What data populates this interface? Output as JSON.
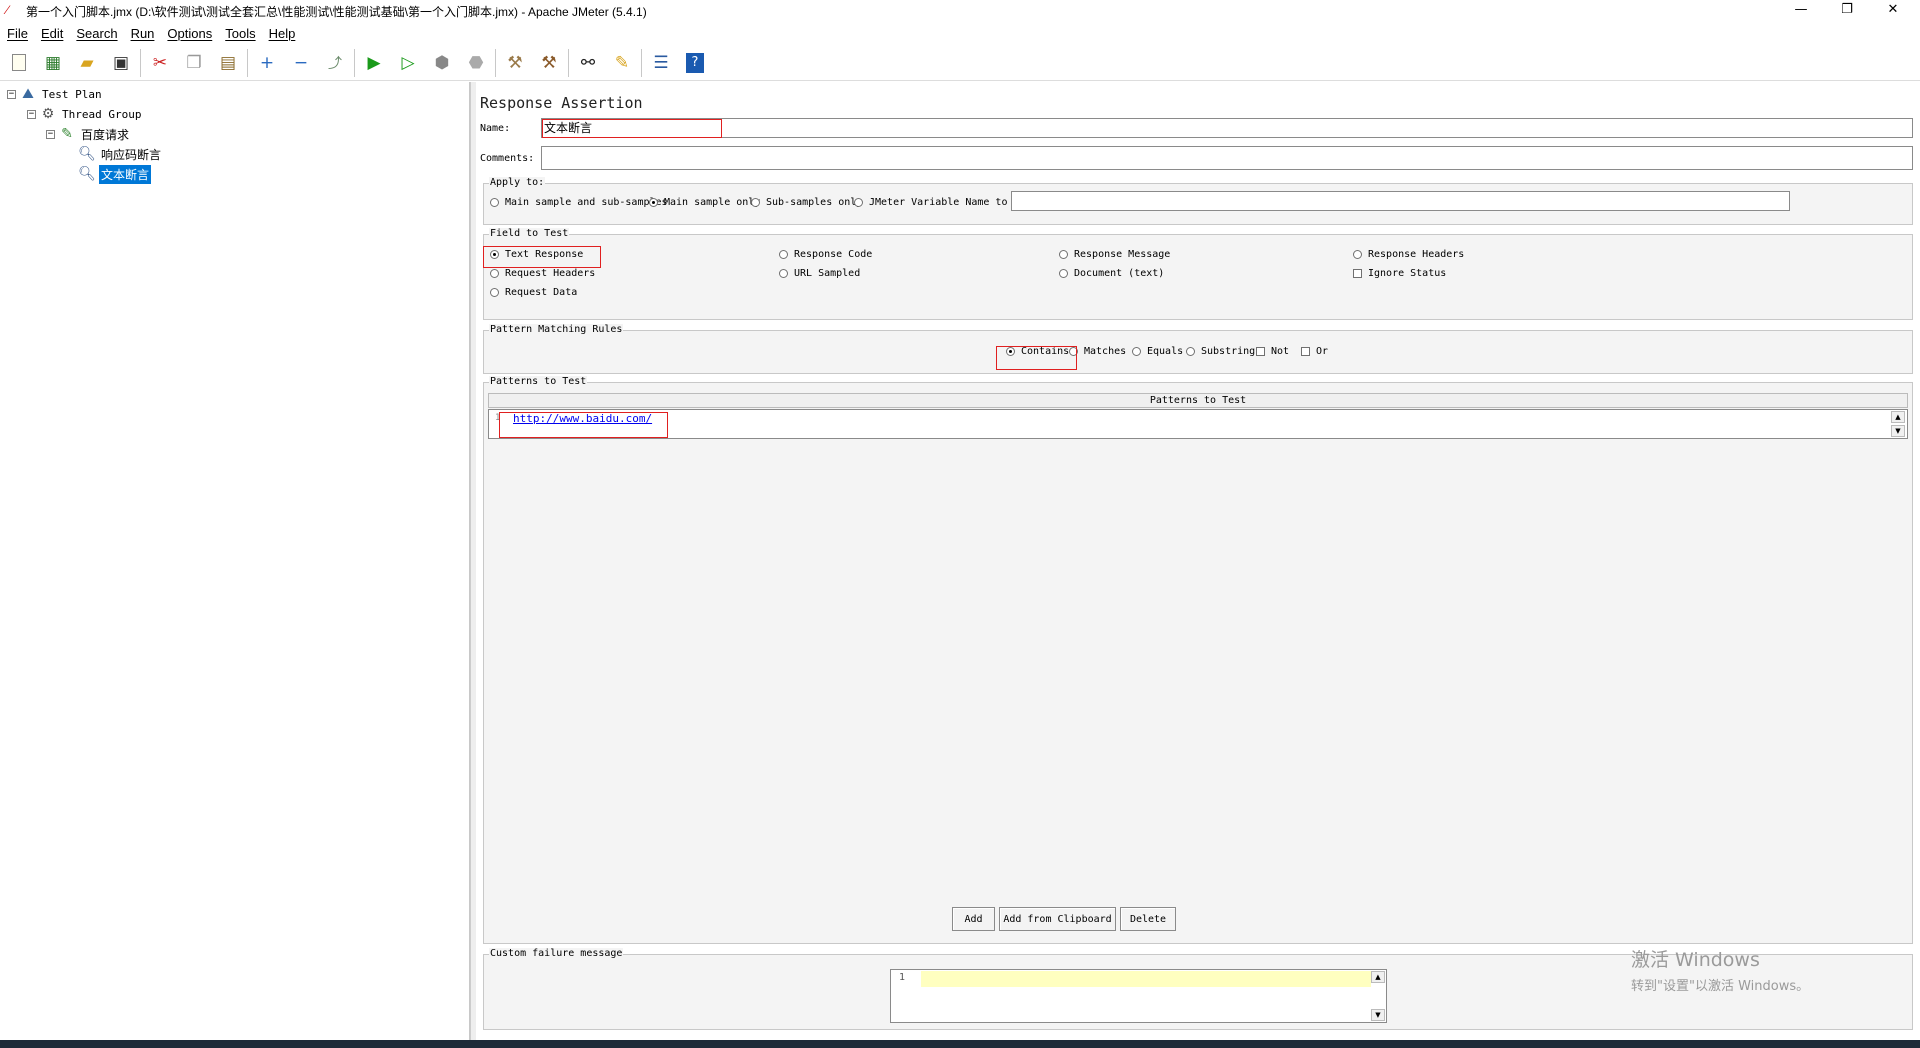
{
  "window": {
    "title": "第一个入门脚本.jmx (D:\\软件测试\\测试全套汇总\\性能测试\\性能测试基础\\第一个入门脚本.jmx) - Apache JMeter (5.4.1)",
    "minimize": "—",
    "restore": "❐",
    "close": "✕"
  },
  "menu": [
    "File",
    "Edit",
    "Search",
    "Run",
    "Options",
    "Tools",
    "Help"
  ],
  "toolbar_icons": [
    "new-icon",
    "templates-icon",
    "open-icon",
    "save-icon",
    "cut-icon",
    "copy-icon",
    "paste-icon",
    "expand-icon",
    "collapse-icon",
    "toggle-icon",
    "start-icon",
    "start-no-pauses-icon",
    "stop-icon",
    "shutdown-icon",
    "clear-icon",
    "clear-all-icon",
    "search-icon",
    "reset-search-icon",
    "function-helper-icon",
    "help-icon"
  ],
  "tree": {
    "test_plan": "Test Plan",
    "thread_group": "Thread Group",
    "sampler": "百度请求",
    "assertion_1": "响应码断言",
    "assertion_2": "文本断言"
  },
  "panel": {
    "title": "Response Assertion",
    "name_label": "Name:",
    "name_value": "文本断言",
    "comments_label": "Comments:",
    "comments_value": "",
    "apply_to": {
      "legend": "Apply to:",
      "options": [
        "Main sample and sub-samples",
        "Main sample only",
        "Sub-samples only",
        "JMeter Variable Name to use"
      ],
      "selected": "Main sample only",
      "variable_value": ""
    },
    "field_to_test": {
      "legend": "Field to Test",
      "options": [
        "Text Response",
        "Response Code",
        "Response Message",
        "Response Headers",
        "Request Headers",
        "URL Sampled",
        "Document (text)",
        "Request Data"
      ],
      "ignore_status": "Ignore Status",
      "selected": "Text Response"
    },
    "pattern_rules": {
      "legend": "Pattern Matching Rules",
      "contains": "Contains",
      "matches": "Matches",
      "equals": "Equals",
      "substring": "Substring",
      "not": "Not",
      "or": "Or",
      "selected": "Contains"
    },
    "patterns": {
      "legend": "Patterns to Test",
      "column_header": "Patterns to Test",
      "row_number": "1",
      "row_value": "http://www.baidu.com/",
      "add": "Add",
      "add_clipboard": "Add from Clipboard",
      "delete": "Delete"
    },
    "failure": {
      "legend": "Custom failure message",
      "line_number": "1",
      "value": ""
    }
  },
  "watermark": {
    "line1": "激活 Windows",
    "line2": "转到\"设置\"以激活 Windows。"
  },
  "colors": {
    "selection": "#0078d7",
    "highlight_box": "#e02020",
    "editor_line": "#ffffc0",
    "panel_bg": "#f4f4f4"
  }
}
